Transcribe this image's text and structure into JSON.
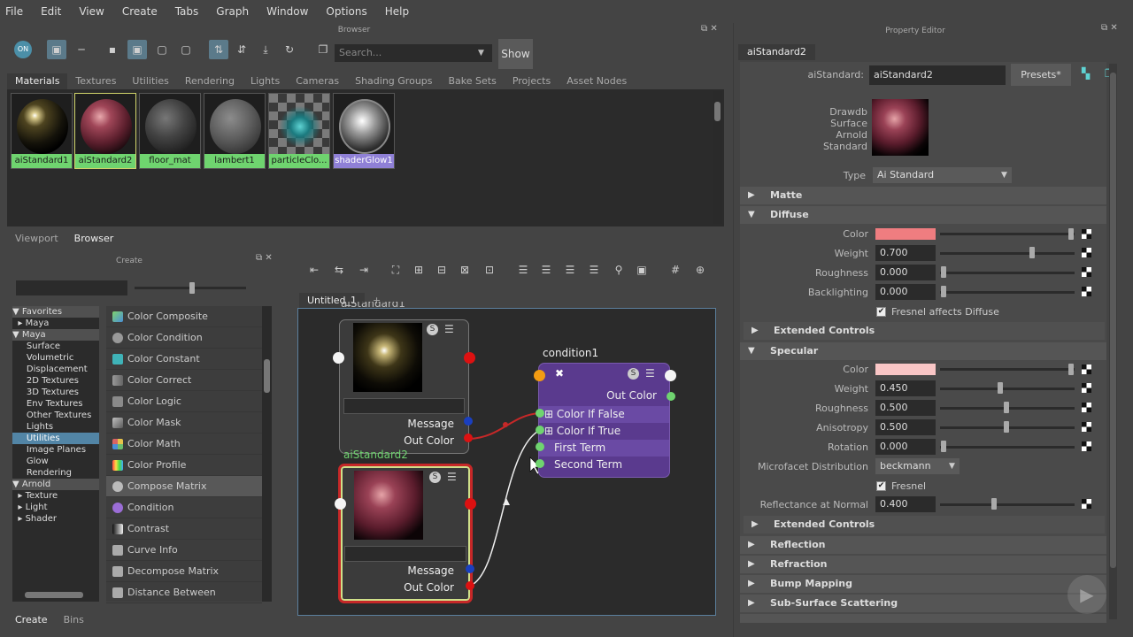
{
  "menu": [
    "File",
    "Edit",
    "View",
    "Create",
    "Tabs",
    "Graph",
    "Window",
    "Options",
    "Help"
  ],
  "browser": {
    "panel_title": "Browser",
    "search_placeholder": "Search...",
    "show_button": "Show",
    "tabs": [
      "Materials",
      "Textures",
      "Utilities",
      "Rendering",
      "Lights",
      "Cameras",
      "Shading Groups",
      "Bake Sets",
      "Projects",
      "Asset Nodes"
    ],
    "swatches": [
      "aiStandard1",
      "aiStandard2",
      "floor_mat",
      "lambert1",
      "particleClo...",
      "shaderGlow1"
    ],
    "bottom_tabs": [
      "Viewport",
      "Browser"
    ]
  },
  "create": {
    "panel_title": "Create",
    "tree": [
      "Favorites",
      "Maya",
      "Maya",
      "Surface",
      "Volumetric",
      "Displacement",
      "2D Textures",
      "3D Textures",
      "Env Textures",
      "Other Textures",
      "Lights",
      "Utilities",
      "Image Planes",
      "Glow",
      "Rendering",
      "Arnold",
      "Texture",
      "Light",
      "Shader"
    ],
    "nodes": [
      "Color Composite",
      "Color Condition",
      "Color Constant",
      "Color Correct",
      "Color Logic",
      "Color Mask",
      "Color Math",
      "Color Profile",
      "Compose Matrix",
      "Condition",
      "Contrast",
      "Curve Info",
      "Decompose Matrix",
      "Distance Between"
    ],
    "bottom_tabs": [
      "Create",
      "Bins"
    ]
  },
  "graph": {
    "tab": "Untitled_1",
    "tab_add": "+",
    "node1": {
      "title": "aiStandard1",
      "msg": "Message",
      "out": "Out Color"
    },
    "node2": {
      "title": "aiStandard2",
      "msg": "Message",
      "out": "Out Color"
    },
    "cond": {
      "title": "condition1",
      "out": "Out Color",
      "attrs": [
        "Color If False",
        "Color If True",
        "First Term",
        "Second Term"
      ]
    }
  },
  "pe": {
    "panel_title": "Property Editor",
    "tab": "aiStandard2",
    "node_label": "aiStandard:",
    "node_name": "aiStandard2",
    "presets": "Presets*",
    "desc": [
      "Drawdb",
      "Surface",
      "Arnold",
      "Standard"
    ],
    "type_label": "Type",
    "type_value": "Ai Standard",
    "sections": {
      "matte": "Matte",
      "diffuse": "Diffuse",
      "ext1": "Extended Controls",
      "specular": "Specular",
      "ext2": "Extended Controls",
      "reflection": "Reflection",
      "refraction": "Refraction",
      "bump": "Bump Mapping",
      "sss": "Sub-Surface Scattering"
    },
    "diffuse": {
      "color_label": "Color",
      "color": "#ef7d80",
      "weight_label": "Weight",
      "weight": "0.700",
      "rough_label": "Roughness",
      "rough": "0.000",
      "back_label": "Backlighting",
      "back": "0.000",
      "fresnel_label": "Fresnel affects Diffuse"
    },
    "specular": {
      "color_label": "Color",
      "color": "#f9c6c6",
      "weight_label": "Weight",
      "weight": "0.450",
      "rough_label": "Roughness",
      "rough": "0.500",
      "aniso_label": "Anisotropy",
      "aniso": "0.500",
      "rot_label": "Rotation",
      "rot": "0.000",
      "micro_label": "Microfacet Distribution",
      "micro": "beckmann",
      "fresnel_label": "Fresnel",
      "refl_label": "Reflectance at Normal",
      "refl": "0.400"
    }
  }
}
